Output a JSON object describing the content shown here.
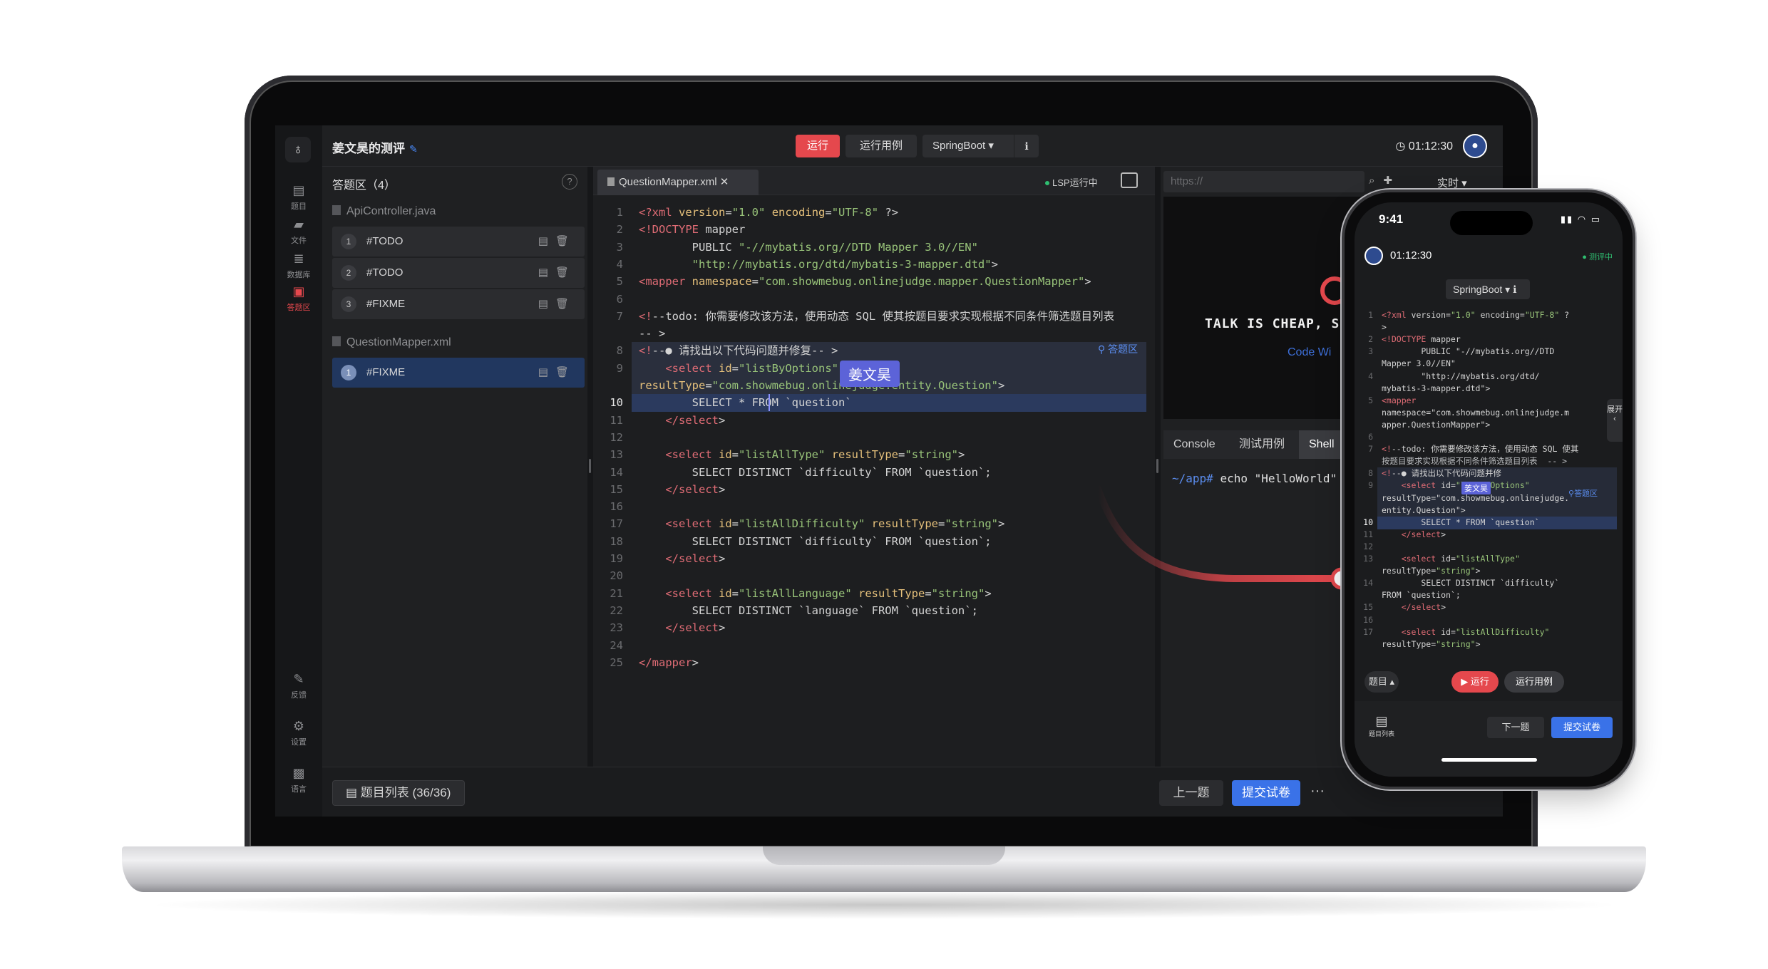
{
  "app": {
    "title": "姜文昊的测评",
    "run_label": "运行",
    "cases_label": "运行用例",
    "framework": "SpringBoot ▾",
    "info_icon": "info-icon",
    "timer": "01:12:30"
  },
  "rail": {
    "items": [
      {
        "label": "题目",
        "icon": "document-icon"
      },
      {
        "label": "文件",
        "icon": "folder-icon"
      },
      {
        "label": "数据库",
        "icon": "database-icon"
      },
      {
        "label": "答题区",
        "icon": "answer-area-icon"
      },
      {
        "label": "反馈",
        "icon": "feedback-icon"
      },
      {
        "label": "设置",
        "icon": "gear-icon"
      },
      {
        "label": "语言",
        "icon": "language-icon"
      }
    ]
  },
  "answer_panel": {
    "heading": "答题区（4）",
    "files": [
      {
        "name": "ApiController.java",
        "items": [
          {
            "num": "1",
            "label": "#TODO"
          },
          {
            "num": "2",
            "label": "#TODO"
          },
          {
            "num": "3",
            "label": "#FIXME"
          }
        ]
      },
      {
        "name": "QuestionMapper.xml",
        "items": [
          {
            "num": "1",
            "label": "#FIXME"
          }
        ]
      }
    ]
  },
  "editor": {
    "tab": "QuestionMapper.xml",
    "lsp_status": "LSP运行中",
    "collaborator": "姜文昊",
    "answer_link": "答题区",
    "current_line": 10,
    "lines": [
      "<?xml version=\"1.0\" encoding=\"UTF-8\" ?>",
      "<!DOCTYPE mapper",
      "        PUBLIC \"-//mybatis.org//DTD Mapper 3.0//EN\"",
      "        \"http://mybatis.org/dtd/mybatis-3-mapper.dtd\">",
      "<mapper namespace=\"com.showmebug.onlinejudge.mapper.QuestionMapper\">",
      "",
      "<!--todo: 你需要修改该方法，使用动态 SQL 使其按题目要求实现根据不同条件筛选题目列表",
      "-- >",
      "<!--● 请找出以下代码问题并修复-- >",
      "    <select id=\"listByOptions\"",
      "resultType=\"com.showmebug.onlinejudge.entity.Question\">",
      "        SELECT * FROM `question`",
      "    </select>",
      "",
      "    <select id=\"listAllType\" resultType=\"string\">",
      "        SELECT DISTINCT `difficulty` FROM `question`;",
      "    </select>",
      "",
      "    <select id=\"listAllDifficulty\" resultType=\"string\">",
      "        SELECT DISTINCT `difficulty` FROM `question`;",
      "    </select>",
      "",
      "    <select id=\"listAllLanguage\" resultType=\"string\">",
      "        SELECT DISTINCT `language` FROM `question`;",
      "    </select>",
      "",
      "</mapper>"
    ],
    "line_numbers": [
      "1",
      "2",
      "3",
      "4",
      "5",
      "6",
      "7",
      "",
      "8",
      "9",
      "",
      "10",
      "11",
      "12",
      "13",
      "14",
      "15",
      "16",
      "17",
      "18",
      "19",
      "20",
      "21",
      "22",
      "23",
      "24",
      "25"
    ]
  },
  "preview": {
    "url_placeholder": "https://",
    "live_label": "实时 ▾",
    "headline": "TALK IS CHEAP, SH",
    "subline": "Code Wi"
  },
  "terminal": {
    "tabs": [
      "Console",
      "测试用例",
      "Shell"
    ],
    "active_tab": "Shell",
    "prompt": "~/app#",
    "command": "echo \"HelloWorld\""
  },
  "bottom": {
    "question_list": "题目列表 (36/36)",
    "prev": "上一题",
    "submit": "提交试卷",
    "more": "···"
  },
  "phone": {
    "clock": "9:41",
    "timer": "01:12:30",
    "status": "● 测评中",
    "framework": "SpringBoot ▾",
    "expand": "展开",
    "collaborator": "姜文昊",
    "answer_link": "答题区",
    "question_btn": "题目 ▴",
    "run": "▶ 运行",
    "cases": "运行用例",
    "question_list": "题目列表",
    "next": "下一题",
    "submit": "提交试卷",
    "lines": [
      {
        "n": "1",
        "t": "<?xml version=\"1.0\" encoding=\"UTF-8\" ?"
      },
      {
        "n": "",
        "t": ">"
      },
      {
        "n": "2",
        "t": "<!DOCTYPE mapper"
      },
      {
        "n": "3",
        "t": "        PUBLIC \"-//mybatis.org//DTD"
      },
      {
        "n": "",
        "t": "Mapper 3.0//EN\""
      },
      {
        "n": "4",
        "t": "        \"http://mybatis.org/dtd/"
      },
      {
        "n": "",
        "t": "mybatis-3-mapper.dtd\">"
      },
      {
        "n": "5",
        "t": "<mapper"
      },
      {
        "n": "",
        "t": "namespace=\"com.showmebug.onlinejudge.m"
      },
      {
        "n": "",
        "t": "apper.QuestionMapper\">"
      },
      {
        "n": "6",
        "t": ""
      },
      {
        "n": "7",
        "t": "<!--todo: 你需要修改该方法，使用动态 SQL 使其"
      },
      {
        "n": "",
        "t": "按题目要求实现根据不同条件筛选题目列表  -- >"
      },
      {
        "n": "8",
        "t": "<!--● 请找出以下代码问题并修"
      },
      {
        "n": "9",
        "t": "    <select id=\"listByOptions\""
      },
      {
        "n": "",
        "t": "resultType=\"com.showmebug.onlinejudge."
      },
      {
        "n": "",
        "t": "entity.Question\">"
      },
      {
        "n": "10",
        "t": "        SELECT * FROM `question`"
      },
      {
        "n": "11",
        "t": "    </select>"
      },
      {
        "n": "12",
        "t": ""
      },
      {
        "n": "13",
        "t": "    <select id=\"listAllType\""
      },
      {
        "n": "",
        "t": "resultType=\"string\">"
      },
      {
        "n": "14",
        "t": "        SELECT DISTINCT `difficulty`"
      },
      {
        "n": "",
        "t": "FROM `question`;"
      },
      {
        "n": "15",
        "t": "    </select>"
      },
      {
        "n": "16",
        "t": ""
      },
      {
        "n": "17",
        "t": "    <select id=\"listAllDifficulty\""
      },
      {
        "n": "",
        "t": "resultType=\"string\">"
      }
    ]
  }
}
